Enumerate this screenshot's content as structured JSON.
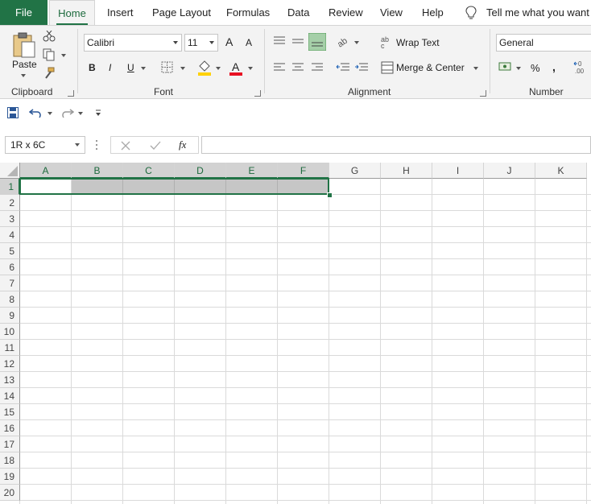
{
  "tabs": {
    "file": "File",
    "home": "Home",
    "insert": "Insert",
    "page_layout": "Page Layout",
    "formulas": "Formulas",
    "data": "Data",
    "review": "Review",
    "view": "View",
    "help": "Help",
    "tell_me": "Tell me what you want to"
  },
  "ribbon": {
    "clipboard": {
      "paste": "Paste",
      "group": "Clipboard"
    },
    "font": {
      "name": "Calibri",
      "size": "11",
      "grow": "A",
      "shrink": "A",
      "bold": "B",
      "italic": "I",
      "underline": "U",
      "font_color_letter": "A",
      "fx_group": "Font",
      "highlight_color": "#ffd100",
      "font_color": "#e81123"
    },
    "alignment": {
      "wrap_text": "Wrap Text",
      "merge_center": "Merge & Center",
      "group": "Alignment"
    },
    "number": {
      "format": "General",
      "percent": "%",
      "comma": ",",
      "group": "Number"
    }
  },
  "formula_bar": {
    "name_box": "1R x 6C",
    "fx": "fx",
    "formula": ""
  },
  "sheet": {
    "columns": [
      "A",
      "B",
      "C",
      "D",
      "E",
      "F",
      "G",
      "H",
      "I",
      "J",
      "K"
    ],
    "rows": [
      "1",
      "2",
      "3",
      "4",
      "5",
      "6",
      "7",
      "8",
      "9",
      "10",
      "11",
      "12",
      "13",
      "14",
      "15",
      "16",
      "17",
      "18",
      "19",
      "20"
    ],
    "selection": "A1:F1",
    "accent": "#217346"
  }
}
